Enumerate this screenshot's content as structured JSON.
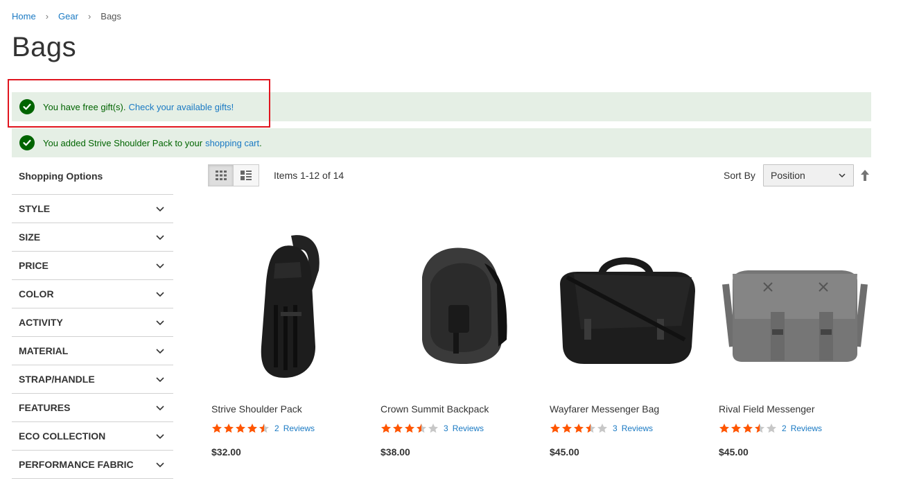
{
  "breadcrumb": {
    "home": "Home",
    "gear": "Gear",
    "current": "Bags",
    "separator": "›"
  },
  "page_title": "Bags",
  "messages": {
    "gift_text": "You have free gift(s).",
    "gift_link": "Check your available gifts!",
    "cart_text_prefix": "You added Strive Shoulder Pack to your",
    "cart_link": "shopping cart",
    "cart_text_suffix": "."
  },
  "sidebar": {
    "title": "Shopping Options",
    "filters": [
      "STYLE",
      "SIZE",
      "PRICE",
      "COLOR",
      "ACTIVITY",
      "MATERIAL",
      "STRAP/HANDLE",
      "FEATURES",
      "ECO COLLECTION",
      "PERFORMANCE FABRIC"
    ]
  },
  "toolbar": {
    "items_count": "Items 1-12 of 14",
    "sort_label": "Sort By",
    "sort_value": "Position"
  },
  "products": [
    {
      "name": "Strive Shoulder Pack",
      "rating": 4.5,
      "review_count": "2",
      "review_label": "Reviews",
      "price": "$32.00"
    },
    {
      "name": "Crown Summit Backpack",
      "rating": 3.5,
      "review_count": "3",
      "review_label": "Reviews",
      "price": "$38.00"
    },
    {
      "name": "Wayfarer Messenger Bag",
      "rating": 3.5,
      "review_count": "3",
      "review_label": "Reviews",
      "price": "$45.00"
    },
    {
      "name": "Rival Field Messenger",
      "rating": 3.5,
      "review_count": "2",
      "review_label": "Reviews",
      "price": "$45.00"
    }
  ],
  "colors": {
    "link": "#1979c3",
    "success_bg": "#e5efe5",
    "success_text": "#006400",
    "star": "#ff5501",
    "star_empty": "#c7c7c7",
    "highlight_box": "#e0141e"
  }
}
